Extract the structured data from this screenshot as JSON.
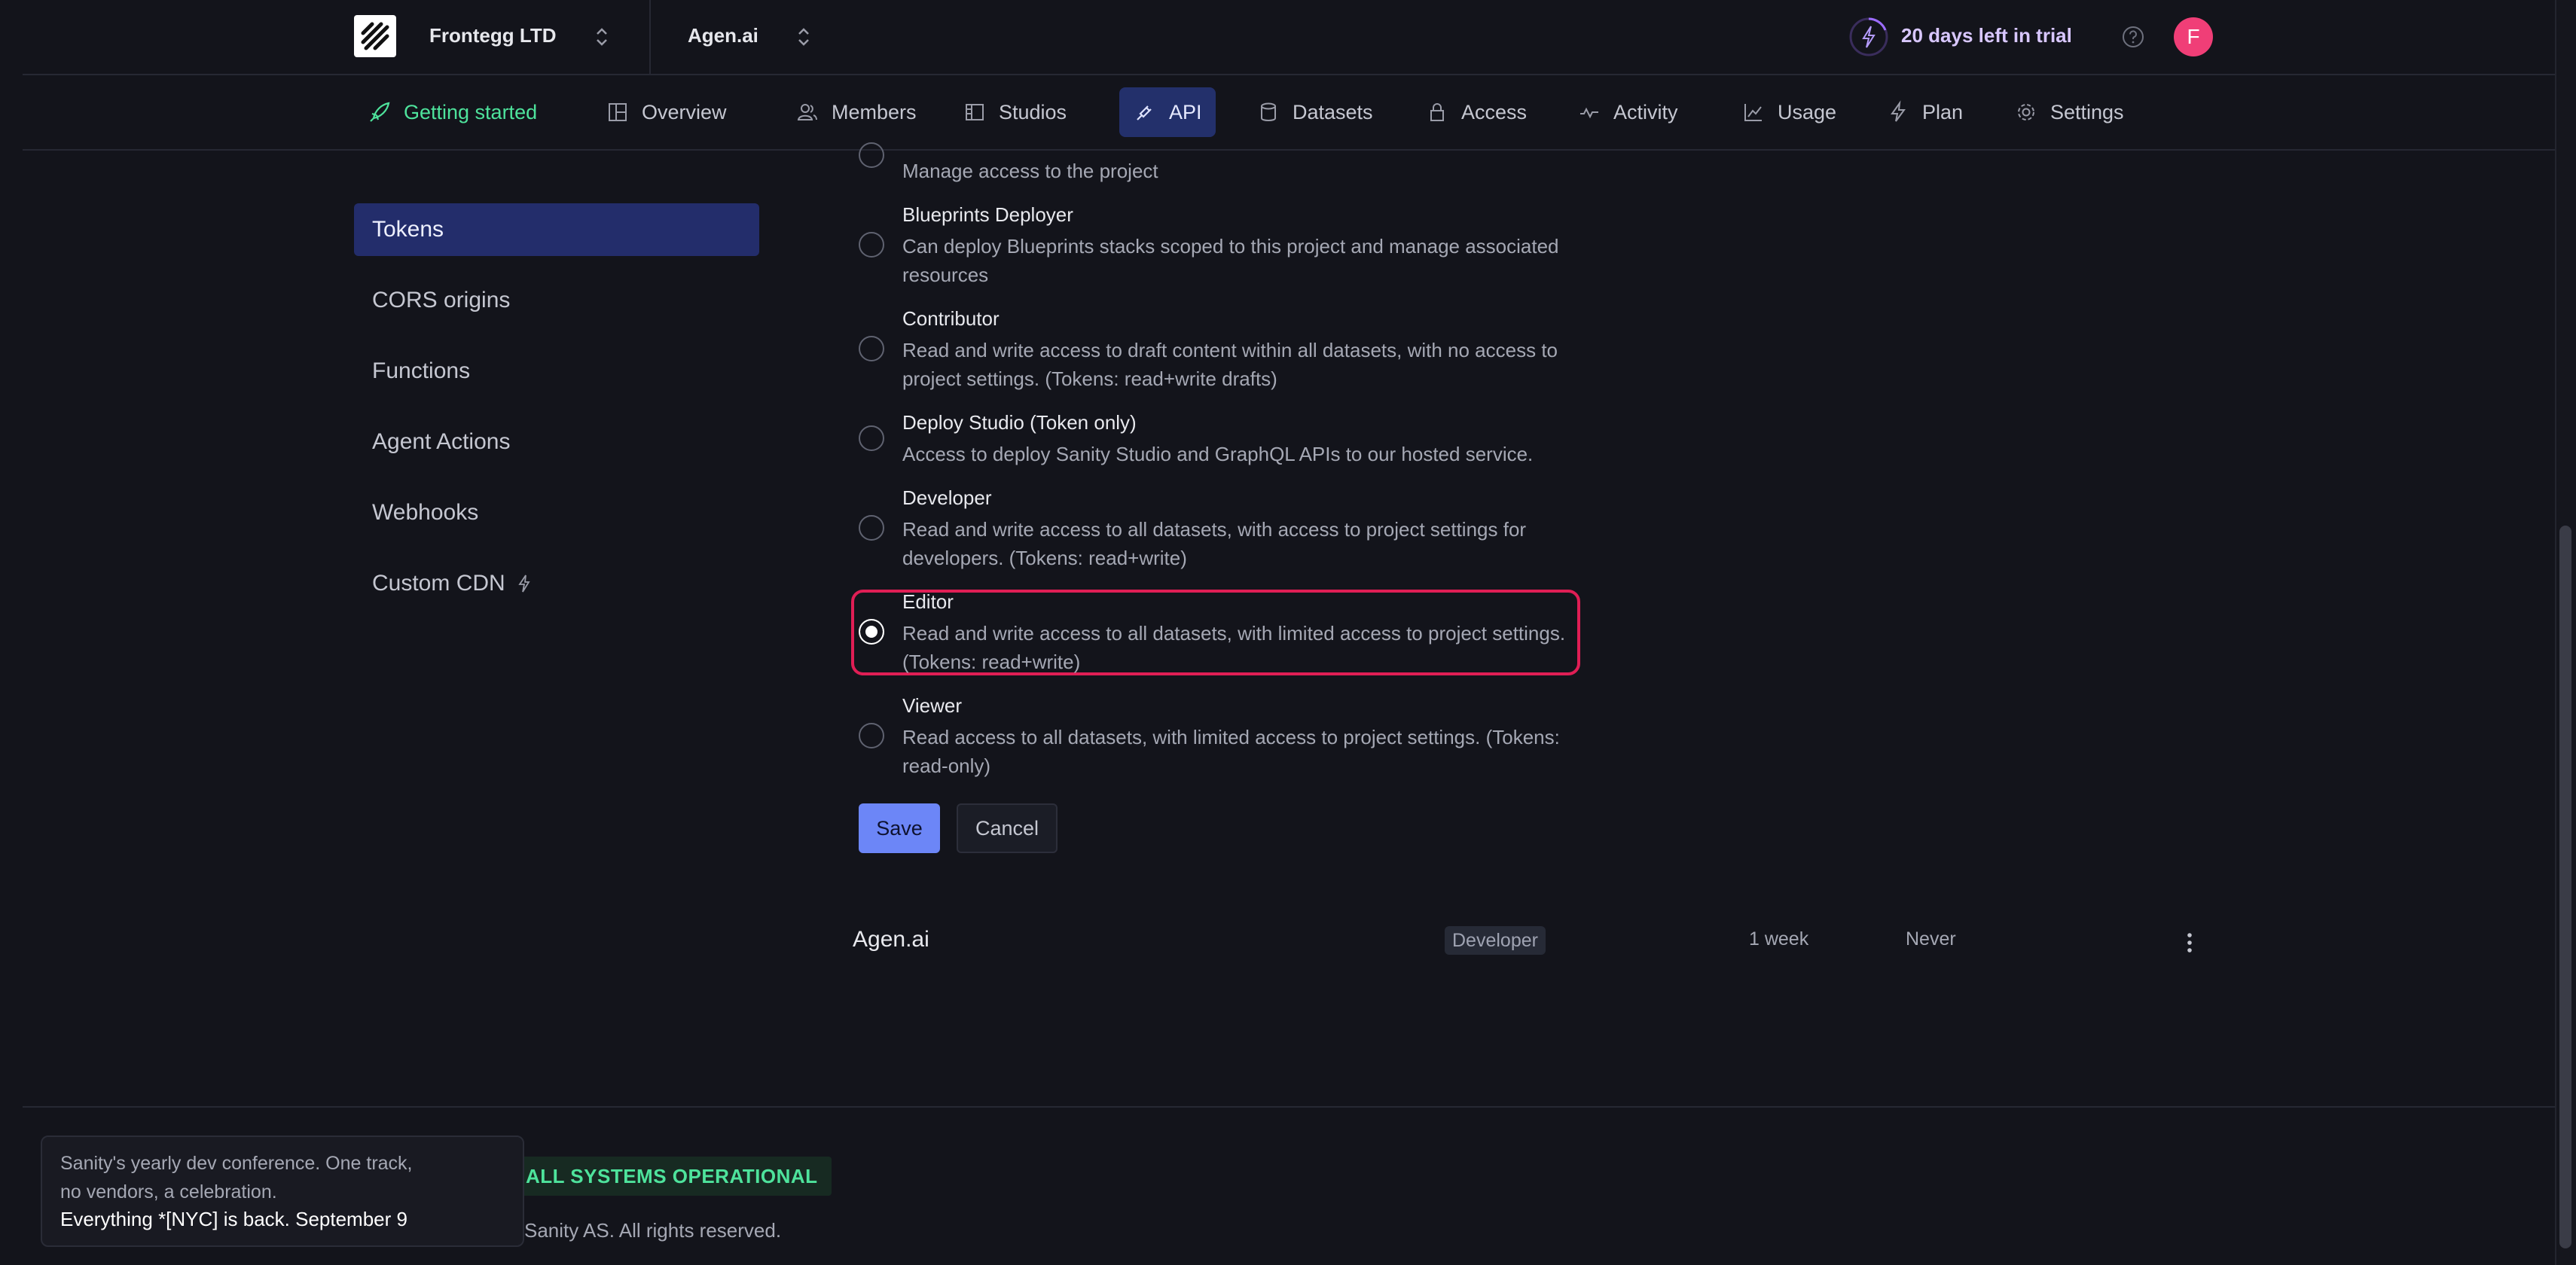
{
  "topbar": {
    "org_name": "Frontegg LTD",
    "project_name": "Agen.ai",
    "trial_text": "20 days left in trial",
    "avatar_letter": "F"
  },
  "nav": {
    "items": [
      {
        "label": "Getting started",
        "icon": "rocket-icon"
      },
      {
        "label": "Overview",
        "icon": "layout-icon"
      },
      {
        "label": "Members",
        "icon": "users-icon"
      },
      {
        "label": "Studios",
        "icon": "studio-icon"
      },
      {
        "label": "API",
        "icon": "plug-icon",
        "active": true
      },
      {
        "label": "Datasets",
        "icon": "database-icon"
      },
      {
        "label": "Access",
        "icon": "lock-icon"
      },
      {
        "label": "Activity",
        "icon": "activity-icon"
      },
      {
        "label": "Usage",
        "icon": "chart-icon"
      },
      {
        "label": "Plan",
        "icon": "bolt-icon"
      },
      {
        "label": "Settings",
        "icon": "gear-icon"
      }
    ]
  },
  "sidebar": {
    "items": [
      {
        "label": "Tokens",
        "active": true
      },
      {
        "label": "CORS origins"
      },
      {
        "label": "Functions"
      },
      {
        "label": "Agent Actions"
      },
      {
        "label": "Webhooks"
      },
      {
        "label": "Custom CDN"
      }
    ]
  },
  "roles": {
    "partial_desc": "Manage access to the project",
    "items": [
      {
        "title": "Blueprints Deployer",
        "desc": "Can deploy Blueprints stacks scoped to this project and manage associated resources"
      },
      {
        "title": "Contributor",
        "desc": "Read and write access to draft content within all datasets, with no access to project settings. (Tokens: read+write drafts)"
      },
      {
        "title": "Deploy Studio (Token only)",
        "desc": "Access to deploy Sanity Studio and GraphQL APIs to our hosted service."
      },
      {
        "title": "Developer",
        "desc": "Read and write access to all datasets, with access to project settings for developers. (Tokens: read+write)"
      },
      {
        "title": "Editor",
        "desc": "Read and write access to all datasets, with limited access to project settings. (Tokens: read+write)",
        "selected": true
      },
      {
        "title": "Viewer",
        "desc": "Read access to all datasets, with limited access to project settings. (Tokens: read-only)"
      }
    ],
    "save_label": "Save",
    "cancel_label": "Cancel"
  },
  "token_row": {
    "name": "Agen.ai",
    "role": "Developer",
    "created": "1 week",
    "last_used": "Never"
  },
  "footer": {
    "status": "ALL SYSTEMS OPERATIONAL",
    "copyright": "Sanity AS. All rights reserved.",
    "promo_text": "Sanity's yearly dev conference. One track, no vendors, a celebration.",
    "promo_cta": "Everything *[NYC] is back. September 9"
  },
  "colors": {
    "background": "#13141b",
    "accent": "#6c86f7",
    "highlight": "#e01e55",
    "success": "#4ee39c",
    "avatar": "#f03e77"
  }
}
